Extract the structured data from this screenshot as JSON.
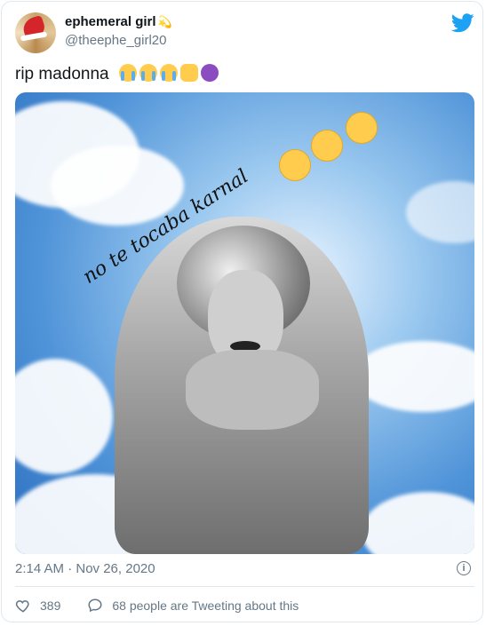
{
  "author": {
    "display_name": "ephemeral girl",
    "name_emoji": "💫",
    "handle": "@theephe_girl20"
  },
  "tweet": {
    "text": "rip madonna",
    "emojis": [
      "crying-face",
      "crying-face",
      "crying-face",
      "oncoming-fist",
      "angry-devil"
    ]
  },
  "media": {
    "overlay_text": "no te tocaba karnal",
    "overlay_emojis": [
      "crying-face",
      "exploding-head",
      "steam-face"
    ]
  },
  "meta": {
    "timestamp": "2:14 AM · Nov 26, 2020",
    "info_icon": "i"
  },
  "actions": {
    "likes": "389",
    "retweeting_text": "68 people are Tweeting about this"
  },
  "colors": {
    "brand": "#1da1f2",
    "secondary_text": "#657786",
    "border": "#e1e8ed"
  }
}
